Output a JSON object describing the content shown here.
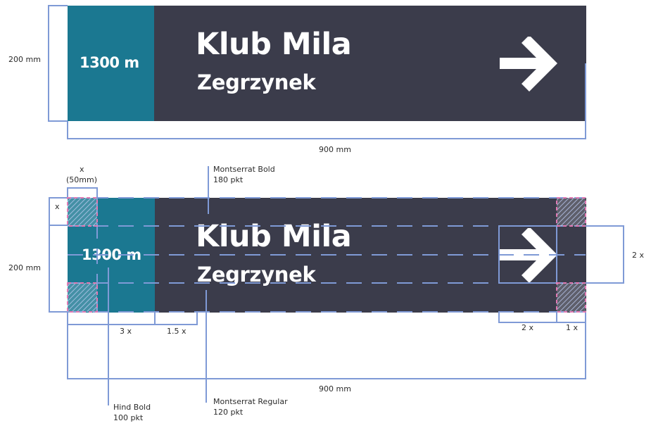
{
  "sign": {
    "distance": "1300 m",
    "title": "Klub Mila",
    "subtitle": "Zegrzynek",
    "arrow_icon": "arrow-right-icon",
    "colors": {
      "teal": "#1b7891",
      "dark": "#3b3c4b",
      "text": "#ffffff",
      "guide": "#7f9ad6",
      "corner": "#e07ab4"
    }
  },
  "top_diagram": {
    "height_label": "200 mm",
    "width_label": "900 mm"
  },
  "spec_diagram": {
    "module_label": "x",
    "module_size_label": "(50mm)",
    "side_x_label": "x",
    "height_label": "200 mm",
    "width_label": "900 mm",
    "title_font_label": "Montserrat Bold",
    "title_size_label": "180 pkt",
    "subtitle_font_label": "Montserrat Regular",
    "subtitle_size_label": "120 pkt",
    "distance_font_label": "Hind Bold",
    "distance_size_label": "100 pkt",
    "dim_3x": "3 x",
    "dim_1_5x": "1.5 x",
    "dim_2x_bottom": "2 x",
    "dim_1x": "1 x",
    "dim_2x_right": "2 x"
  }
}
